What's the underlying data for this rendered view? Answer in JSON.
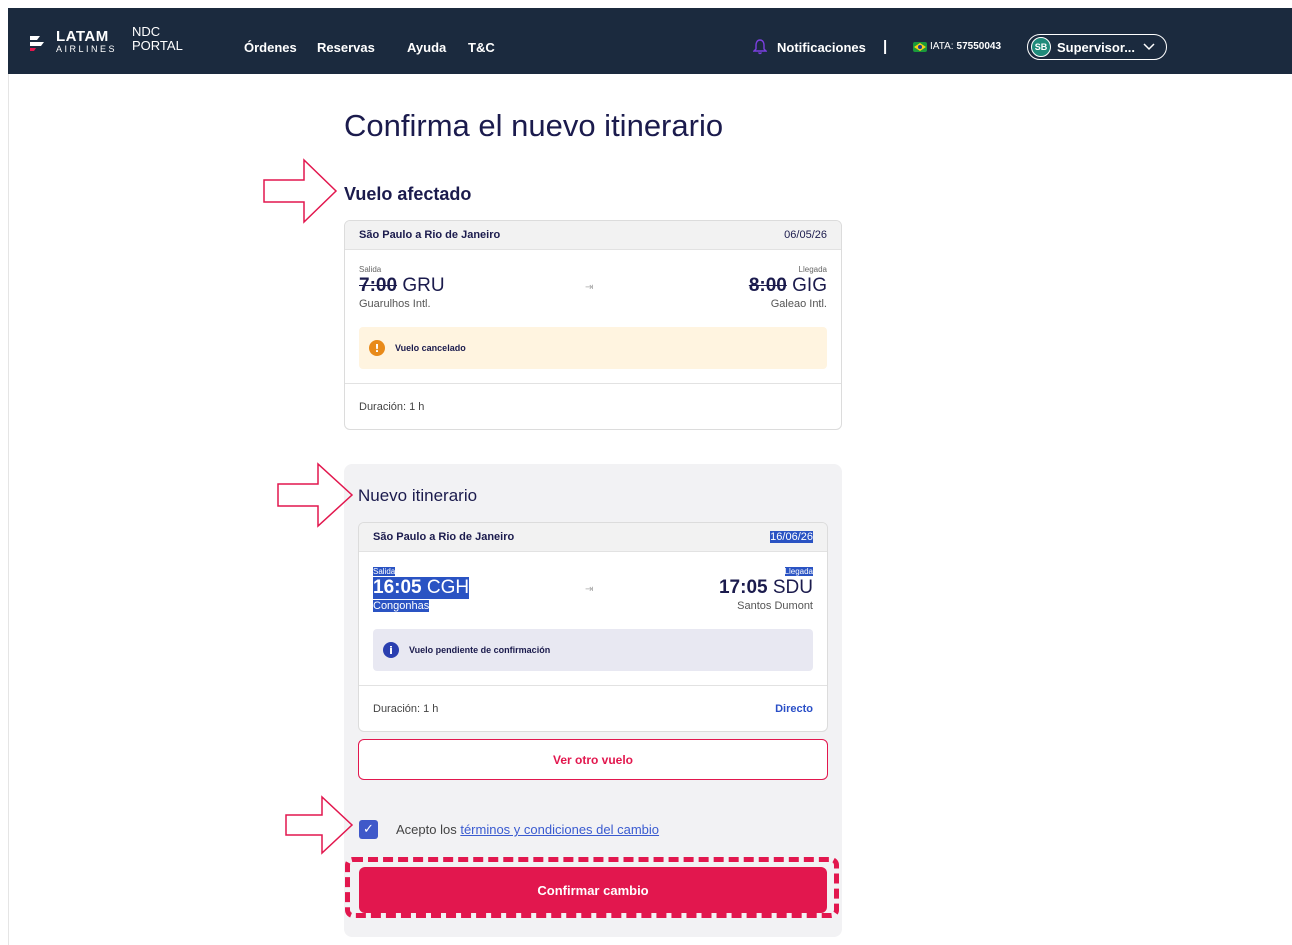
{
  "header": {
    "brand_name": "LATAM",
    "brand_sub": "AIRLINES",
    "portal_line1": "NDC",
    "portal_line2": "PORTAL",
    "nav": [
      "Órdenes",
      "Reservas",
      "Ayuda",
      "T&C"
    ],
    "notifications_label": "Notificaciones",
    "separator": "|",
    "iata_label": "IATA:",
    "iata_value": "57550043",
    "user_initials": "SB",
    "user_name": "Supervisor..."
  },
  "page": {
    "title": "Confirma el nuevo itinerario"
  },
  "affected": {
    "heading": "Vuelo afectado",
    "route": "São Paulo a Rio de Janeiro",
    "date": "06/05/26",
    "dep_label": "Salida",
    "dep_time": "7:00",
    "dep_code": "GRU",
    "dep_airport": "Guarulhos Intl.",
    "arr_label": "Llegada",
    "arr_time": "8:00",
    "arr_code": "GIG",
    "arr_airport": "Galeao Intl.",
    "alert": "Vuelo cancelado",
    "duration": "Duración: 1 h"
  },
  "new_itinerary": {
    "heading": "Nuevo itinerario",
    "route": "São Paulo a Rio de Janeiro",
    "date": "16/06/26",
    "dep_label": "Salida",
    "dep_time": "16:05",
    "dep_code": "CGH",
    "dep_airport": "Congonhas",
    "arr_label": "Llegada",
    "arr_time": "17:05",
    "arr_code": "SDU",
    "arr_airport": "Santos Dumont",
    "alert": "Vuelo pendiente de confirmación",
    "duration": "Duración: 1 h",
    "type": "Directo"
  },
  "actions": {
    "other_flight": "Ver otro vuelo",
    "terms_prefix": "Acepto los",
    "terms_link": "términos y condiciones del cambio",
    "terms_checked": true,
    "confirm": "Confirmar cambio"
  },
  "colors": {
    "topbar": "#1b2a3e",
    "accent": "#e2174e",
    "primary_blue": "#3f59c9",
    "warning": "#e88a1a",
    "warning_bg": "#fff4e0"
  }
}
